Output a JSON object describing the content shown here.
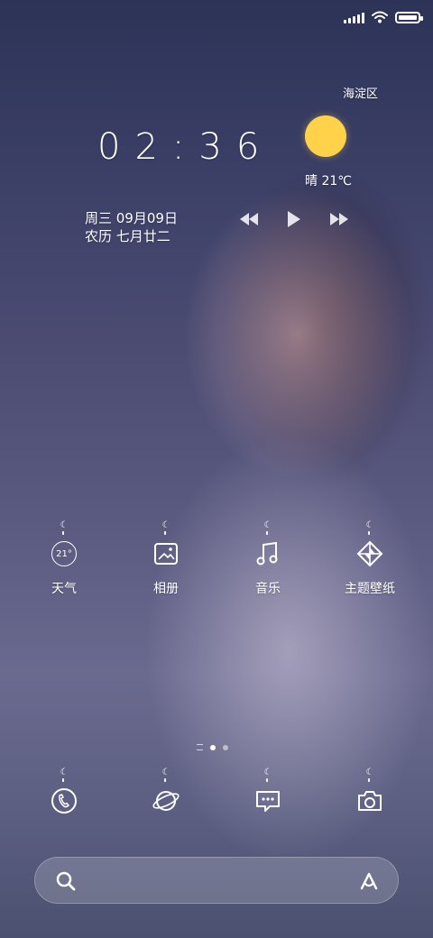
{
  "status_bar": {
    "signal_icon": "signal-bars-icon",
    "wifi_icon": "wifi-icon",
    "battery_icon": "battery-full-icon"
  },
  "clock": {
    "time": "02:36",
    "date_line": "周三 09月09日",
    "lunar_line": "农历 七月廿二"
  },
  "weather": {
    "district": "海淀区",
    "icon": "sun-icon",
    "condition_temp": "晴 21℃"
  },
  "music": {
    "prev_icon": "rewind-icon",
    "play_icon": "play-icon",
    "next_icon": "fast-forward-icon"
  },
  "apps": [
    {
      "label": "天气",
      "icon": "weather-temp-icon",
      "temp": "21°"
    },
    {
      "label": "相册",
      "icon": "gallery-icon"
    },
    {
      "label": "音乐",
      "icon": "music-note-icon"
    },
    {
      "label": "主题壁纸",
      "icon": "theme-icon"
    }
  ],
  "dock": [
    {
      "icon": "phone-icon"
    },
    {
      "icon": "browser-planet-icon"
    },
    {
      "icon": "messages-icon"
    },
    {
      "icon": "camera-icon"
    }
  ],
  "pager": {
    "current_page": 1,
    "page_count": 2
  },
  "search": {
    "search_icon": "search-icon",
    "assistant_icon": "assistant-a-icon"
  }
}
